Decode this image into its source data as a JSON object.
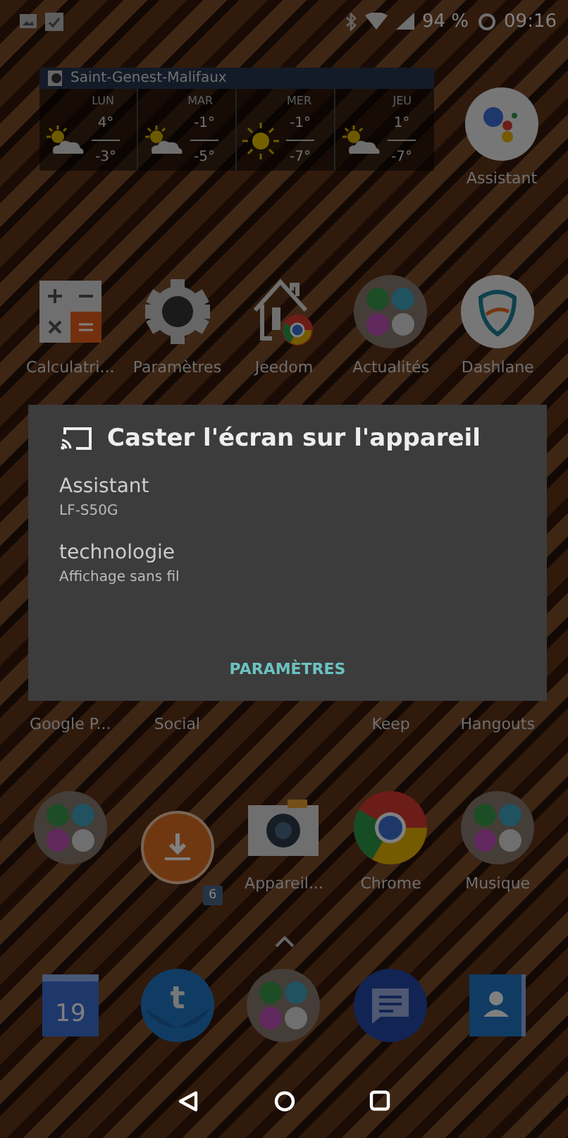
{
  "status_bar": {
    "battery": "94 %",
    "time": "09:16"
  },
  "weather": {
    "location": "Saint-Genest-Malifaux",
    "days": [
      {
        "day": "LUN",
        "kind": "partly",
        "high": "4°",
        "low": "-3°"
      },
      {
        "day": "MAR",
        "kind": "partly",
        "high": "-1°",
        "low": "-5°"
      },
      {
        "day": "MER",
        "kind": "sun",
        "high": "-1°",
        "low": "-7°"
      },
      {
        "day": "JEU",
        "kind": "partly",
        "high": "1°",
        "low": "-7°"
      }
    ]
  },
  "assistant": {
    "label": "Assistant"
  },
  "apps": [
    {
      "kind": "calculator",
      "label": "Calculatri..."
    },
    {
      "kind": "gear",
      "label": "Paramètres"
    },
    {
      "kind": "house",
      "label": "Jeedom"
    },
    {
      "kind": "folder",
      "label": "Actualités"
    },
    {
      "kind": "shield",
      "label": "Dashlane"
    }
  ],
  "covered_row": [
    "Google P...",
    "Social",
    "Keep",
    "Hangouts"
  ],
  "apps_row_2": [
    {
      "kind": "folder"
    },
    {
      "kind": "download",
      "badge": "6"
    },
    {
      "kind": "camera",
      "label": "Appareil..."
    },
    {
      "kind": "browser",
      "label": "Chrome"
    },
    {
      "kind": "folder",
      "label": "Musique"
    }
  ],
  "dock": [
    {
      "kind": "calendar",
      "text": "19"
    },
    {
      "kind": "mail",
      "text": "t"
    },
    {
      "kind": "folder"
    },
    {
      "kind": "chat"
    },
    {
      "kind": "contact"
    }
  ],
  "dialog": {
    "title": "Caster l'écran sur l'appareil",
    "devices": [
      {
        "name": "Assistant",
        "detail": "LF-S50G"
      },
      {
        "name": "technologie",
        "detail": "Affichage sans fil"
      }
    ],
    "button": "PARAMÈTRES"
  }
}
